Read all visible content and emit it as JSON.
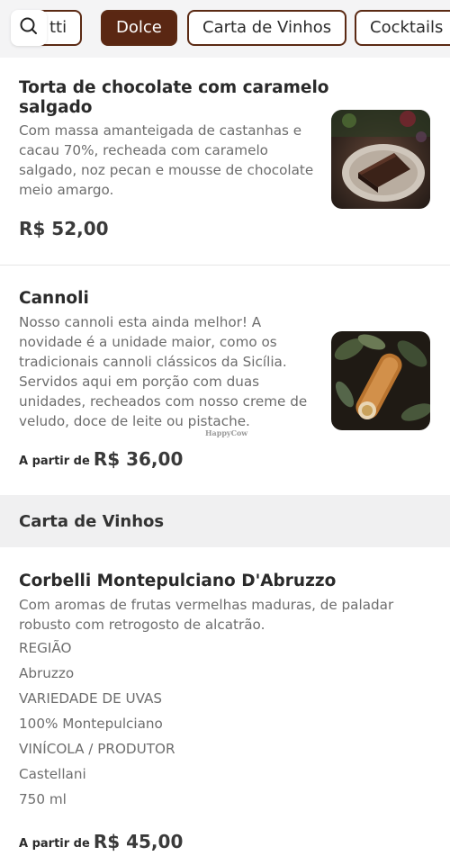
{
  "tabs": [
    {
      "label": "tti",
      "active": false
    },
    {
      "label": "Dolce",
      "active": true
    },
    {
      "label": "Carta de Vinhos",
      "active": false
    },
    {
      "label": "Cocktails",
      "active": false
    }
  ],
  "search": {
    "icon": "search-icon"
  },
  "items": [
    {
      "title_lines": [
        "Torta de chocolate com caramelo",
        "salgado"
      ],
      "desc_lines": [
        "Com massa amanteigada de castanhas e",
        "cacau 70%, recheada com caramelo",
        "salgado, noz pecan e mousse de chocolate",
        "meio amargo."
      ],
      "price": "R$ 52,00",
      "price_prefix": ""
    },
    {
      "title_lines": [
        "Cannoli"
      ],
      "desc_lines": [
        "Nosso cannoli esta ainda melhor! A",
        "novidade é a unidade maior, como os",
        "tradicionais cannoli clássicos da Sicília.",
        "Servidos aqui em porção com duas",
        "unidades, recheados com nosso creme de",
        "veludo, doce de leite ou pistache."
      ],
      "price": "R$ 36,00",
      "price_prefix": "A partir de"
    }
  ],
  "section": {
    "title": "Carta de Vinhos"
  },
  "wine": {
    "title": "Corbelli Montepulciano D'Abruzzo",
    "desc_lines": [
      "Com aromas de frutas vermelhas maduras, de paladar",
      "robusto com retrogosto de alcatrão."
    ],
    "details": [
      "REGIÃO",
      "Abruzzo",
      "VARIEDADE DE UVAS",
      "100% Montepulciano",
      "VINÍCOLA / PRODUTOR",
      "Castellani",
      "750 ml"
    ],
    "price": "R$ 45,00",
    "price_prefix": "A partir de"
  },
  "watermark": "HappyCow",
  "colors": {
    "accent": "#5a2713",
    "topbar_bg": "#f4f4f5",
    "section_bg": "#f0f0f1",
    "text_muted": "#6d6d6d"
  }
}
